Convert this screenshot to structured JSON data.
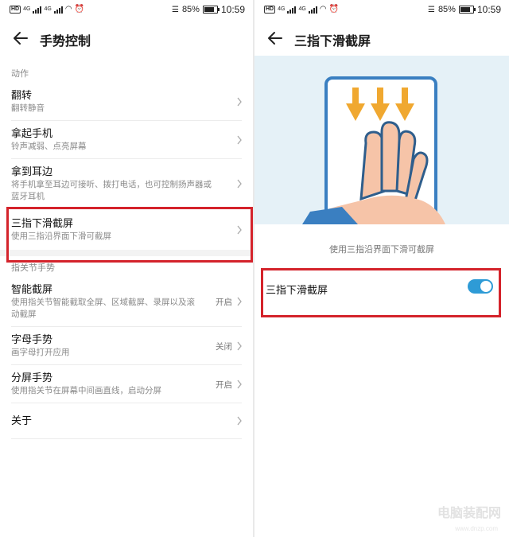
{
  "status_left": {
    "network1": "4G",
    "network2": "4G",
    "hd": "HD"
  },
  "status_right": {
    "battery_pct": "85%",
    "time": "10:59"
  },
  "left_screen": {
    "title": "手势控制",
    "section_actions": "动作",
    "items": [
      {
        "title": "翻转",
        "subtitle": "翻转静音"
      },
      {
        "title": "拿起手机",
        "subtitle": "铃声减弱、点亮屏幕"
      },
      {
        "title": "拿到耳边",
        "subtitle": "将手机拿至耳边可接听、拨打电话，也可控制扬声器或蓝牙耳机"
      },
      {
        "title": "三指下滑截屏",
        "subtitle": "使用三指沿界面下滑可截屏"
      }
    ],
    "section_knuckle": "指关节手势",
    "knuckle_items": [
      {
        "title": "智能截屏",
        "subtitle": "使用指关节智能截取全屏、区域截屏、录屏以及滚动截屏",
        "value": "开启"
      },
      {
        "title": "字母手势",
        "subtitle": "画字母打开应用",
        "value": "关闭"
      },
      {
        "title": "分屏手势",
        "subtitle": "使用指关节在屏幕中间画直线，启动分屏",
        "value": "开启"
      }
    ],
    "about": "关于"
  },
  "right_screen": {
    "title": "三指下滑截屏",
    "caption": "使用三指沿界面下滑可截屏",
    "toggle_label": "三指下滑截屏",
    "toggle_on": true
  },
  "colors": {
    "accent": "#2e9bd6",
    "highlight": "#d4232b",
    "arrow": "#f0a830"
  },
  "watermark": {
    "main": "电脑装配网",
    "sub": "www.dnzp.com"
  }
}
